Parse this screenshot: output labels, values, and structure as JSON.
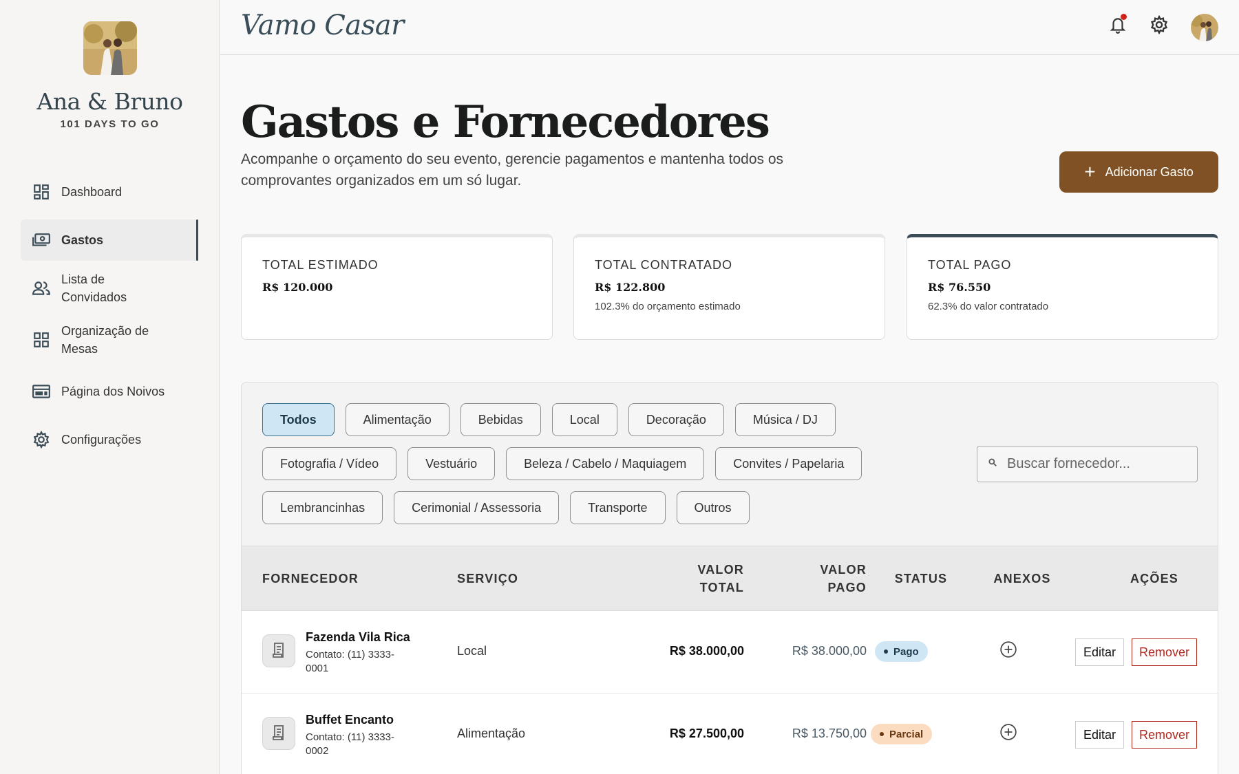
{
  "app": {
    "brand": "Vamo Casar"
  },
  "sidebar": {
    "couple_name": "Ana & Bruno",
    "countdown": "101 DAYS TO GO",
    "items": [
      {
        "label": "Dashboard",
        "icon": "dashboard-icon"
      },
      {
        "label": "Gastos",
        "icon": "money-icon",
        "active": true
      },
      {
        "label": "Lista de Convidados",
        "icon": "people-icon"
      },
      {
        "label": "Organização de Mesas",
        "icon": "grid-icon"
      },
      {
        "label": "Página dos Noivos",
        "icon": "web-icon"
      },
      {
        "label": "Configurações",
        "icon": "gear-icon"
      }
    ]
  },
  "topbar": {
    "notification_dot_color": "#d0241b"
  },
  "page": {
    "title": "Gastos e Fornecedores",
    "subtitle": "Acompanhe o orçamento do seu evento, gerencie pagamentos e mantenha todos os comprovantes organizados em um só lugar.",
    "add_button": "Adicionar Gasto"
  },
  "stats": [
    {
      "label": "TOTAL ESTIMADO",
      "value": "R$ 120.000",
      "note": ""
    },
    {
      "label": "TOTAL CONTRATADO",
      "value": "R$ 122.800",
      "note": "102.3% do orçamento estimado"
    },
    {
      "label": "TOTAL PAGO",
      "value": "R$ 76.550",
      "note": "62.3% do valor contratado"
    }
  ],
  "filters": {
    "rows": [
      [
        "Todos",
        "Alimentação",
        "Bebidas",
        "Local",
        "Decoração",
        "Música / DJ"
      ],
      [
        "Fotografia / Vídeo",
        "Vestuário",
        "Beleza / Cabelo / Maquiagem",
        "Convites / Papelaria"
      ],
      [
        "Lembrancinhas",
        "Cerimonial / Assessoria",
        "Transporte",
        "Outros"
      ]
    ],
    "active": "Todos"
  },
  "search": {
    "placeholder": "Buscar fornecedor..."
  },
  "table": {
    "headers": {
      "vendor": "FORNECEDOR",
      "service": "SERVIÇO",
      "total_1": "VALOR",
      "total_2": "TOTAL",
      "paid_1": "VALOR",
      "paid_2": "PAGO",
      "status": "STATUS",
      "attachments": "ANEXOS",
      "actions": "AÇÕES"
    },
    "rows": [
      {
        "vendor": "Fazenda Vila Rica",
        "contact": "Contato: (11) 3333-0001",
        "service": "Local",
        "total": "R$ 38.000,00",
        "paid": "R$ 38.000,00",
        "status": "Pago",
        "edit": "Editar",
        "remove": "Remover"
      },
      {
        "vendor": "Buffet Encanto",
        "contact": "Contato: (11) 3333-0002",
        "service": "Alimentação",
        "total": "R$ 27.500,00",
        "paid": "R$ 13.750,00",
        "status": "Parcial",
        "edit": "Editar",
        "remove": "Remover"
      }
    ]
  },
  "colors": {
    "accent_brown": "#7f5124",
    "slate": "#3c4c57",
    "paid_badge": "#cfe6f4",
    "partial_badge": "#fbdcc0",
    "remove_red": "#b3261e"
  }
}
